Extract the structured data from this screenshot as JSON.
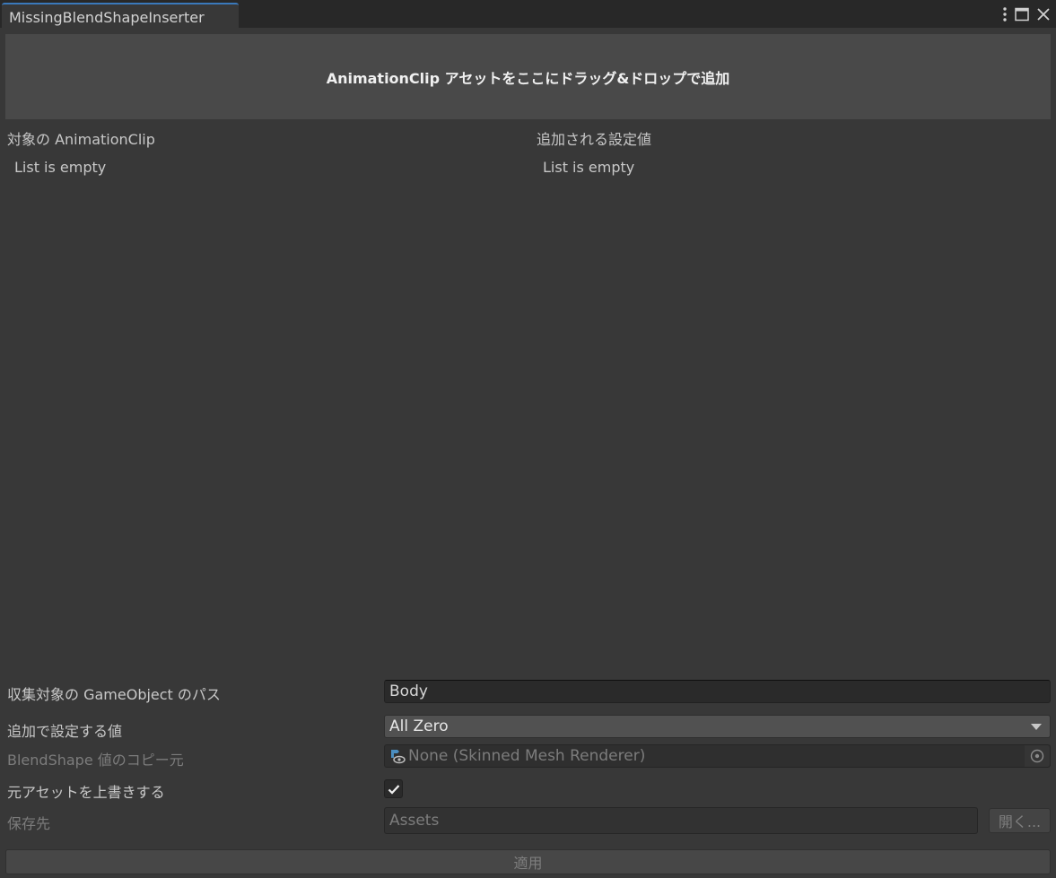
{
  "window": {
    "tab_title": "MissingBlendShapeInserter",
    "controls": [
      "kebab-menu-icon",
      "maximize-icon",
      "close-icon"
    ]
  },
  "dropzone": {
    "label": "AnimationClip アセットをここにドラッグ&ドロップで追加"
  },
  "lists": {
    "left": {
      "header": "対象の AnimationClip",
      "empty_text": "List is empty"
    },
    "right": {
      "header": "追加される設定値",
      "empty_text": "List is empty"
    }
  },
  "form": {
    "gameobject_path": {
      "label": "収集対象の GameObject のパス",
      "value": "Body"
    },
    "additional_value": {
      "label": "追加で設定する値",
      "selected": "All Zero"
    },
    "blendshape_source": {
      "label": "BlendShape 値のコピー元",
      "value": "None (Skinned Mesh Renderer)",
      "icon": "skinned-mesh-renderer-icon"
    },
    "overwrite": {
      "label": "元アセットを上書きする",
      "checked": true
    },
    "save_to": {
      "label": "保存先",
      "placeholder": "Assets",
      "open_label": "開く..."
    }
  },
  "footer": {
    "apply_label": "適用"
  },
  "colors": {
    "accent": "#3a79bb",
    "background": "#383838",
    "titlebar": "#282828",
    "dropzone": "#494949",
    "icon_blue": "#4b8ec0"
  }
}
